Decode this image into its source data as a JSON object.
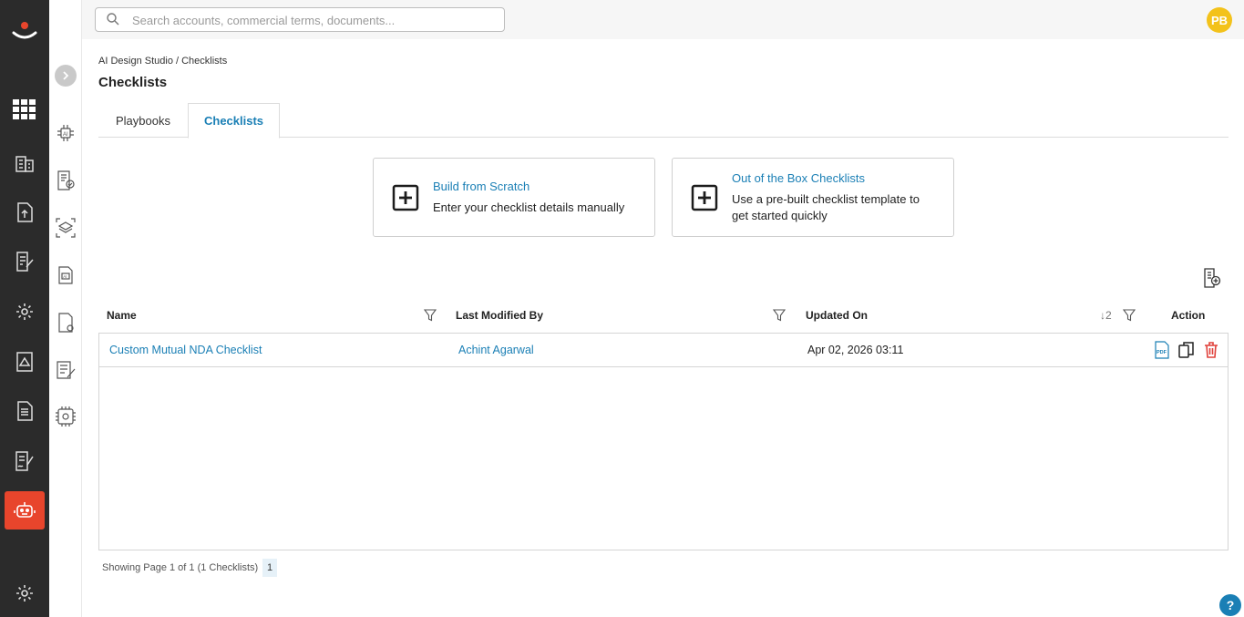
{
  "header": {
    "search_placeholder": "Search accounts, commercial terms, documents...",
    "avatar_initials": "PB"
  },
  "breadcrumb": "AI Design Studio / Checklists",
  "page_title": "Checklists",
  "tabs": [
    {
      "label": "Playbooks",
      "active": false
    },
    {
      "label": "Checklists",
      "active": true
    }
  ],
  "cards": [
    {
      "title": "Build from Scratch",
      "description": "Enter your checklist details manually"
    },
    {
      "title": "Out of the Box Checklists",
      "description": "Use a pre-built checklist template to get started quickly"
    }
  ],
  "table": {
    "columns": [
      "Name",
      "Last Modified By",
      "Updated On",
      "Action"
    ],
    "sort_indicator": "↓2",
    "rows": [
      {
        "name": "Custom Mutual NDA Checklist",
        "modified_by": "Achint Agarwal",
        "updated_on": "Apr 02, 2026 03:11"
      }
    ]
  },
  "pagination": {
    "summary": "Showing Page 1 of 1 (1 Checklists)",
    "current_page": "1"
  },
  "help_label": "?",
  "colors": {
    "accent": "#1a7fb5",
    "rail_bg": "#2b2b2b",
    "active_rail": "#e8452c",
    "avatar": "#f3c21b",
    "delete": "#e0403a"
  }
}
